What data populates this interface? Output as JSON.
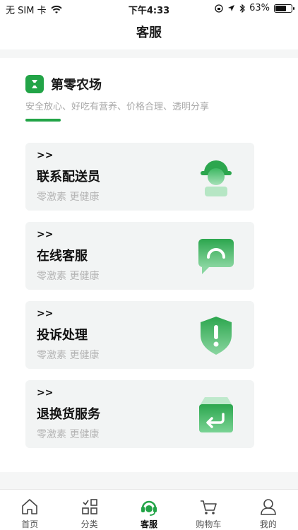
{
  "status_bar": {
    "carrier": "无 SIM 卡",
    "time": "下午4:33",
    "battery_percent": "63%",
    "battery_level": 0.63
  },
  "header": {
    "title": "客服"
  },
  "brand": {
    "name": "第零农场",
    "tagline": "安全放心、好吃有营养、价格合理、透明分享",
    "accent_color": "#22a447"
  },
  "cards": [
    {
      "chevron": ">>",
      "title": "联系配送员",
      "desc": "零激素 更健康",
      "icon": "delivery-person-icon"
    },
    {
      "chevron": ">>",
      "title": "在线客服",
      "desc": "零激素 更健康",
      "icon": "chat-bubble-icon"
    },
    {
      "chevron": ">>",
      "title": "投诉处理",
      "desc": "零激素 更健康",
      "icon": "shield-alert-icon"
    },
    {
      "chevron": ">>",
      "title": "退换货服务",
      "desc": "零激素 更健康",
      "icon": "return-box-icon"
    }
  ],
  "tabs": [
    {
      "label": "首页",
      "icon": "home-icon"
    },
    {
      "label": "分类",
      "icon": "category-grid-icon"
    },
    {
      "label": "客服",
      "icon": "headset-icon"
    },
    {
      "label": "购物车",
      "icon": "cart-icon"
    },
    {
      "label": "我的",
      "icon": "user-icon"
    }
  ]
}
